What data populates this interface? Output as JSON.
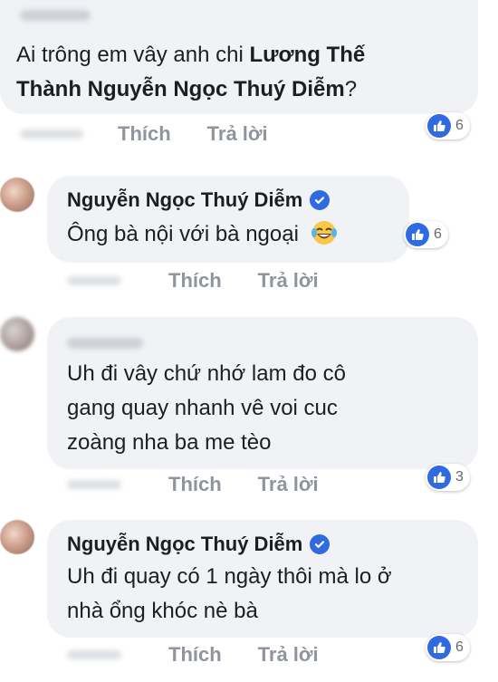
{
  "comments": [
    {
      "author": "",
      "verified": false,
      "text_plain": "Ai trông em vây anh chi ",
      "text_bold_1": "Lương Thế",
      "text_bold_2": "Thành Nguyễn Ngọc Thuý Diễm",
      "text_end": "?",
      "like_label": "Thích",
      "reply_label": "Trả lời",
      "reactions": "6"
    },
    {
      "author": "Nguyễn Ngọc Thuý Diễm",
      "verified": true,
      "text": "Ông bà nội với bà ngoại",
      "emoji": "laughing-tears",
      "like_label": "Thích",
      "reply_label": "Trả lời",
      "reactions": "6"
    },
    {
      "author": "",
      "verified": false,
      "line1": "Uh đi vây chứ nhớ lam đo cô",
      "line2": "gang quay nhanh vê voi cuc",
      "line3": "zoàng nha ba me tèo",
      "like_label": "Thích",
      "reply_label": "Trả lời",
      "reactions": "3"
    },
    {
      "author": "Nguyễn Ngọc Thuý Diễm",
      "verified": true,
      "line1": "Uh đi quay có 1 ngày thôi mà lo ở",
      "line2": "nhà ổng khóc nè bà",
      "like_label": "Thích",
      "reply_label": "Trả lời",
      "reactions": "6"
    }
  ],
  "colors": {
    "bubble": "#f0f2f5",
    "accent": "#2f6ae0",
    "meta": "#90949c"
  }
}
